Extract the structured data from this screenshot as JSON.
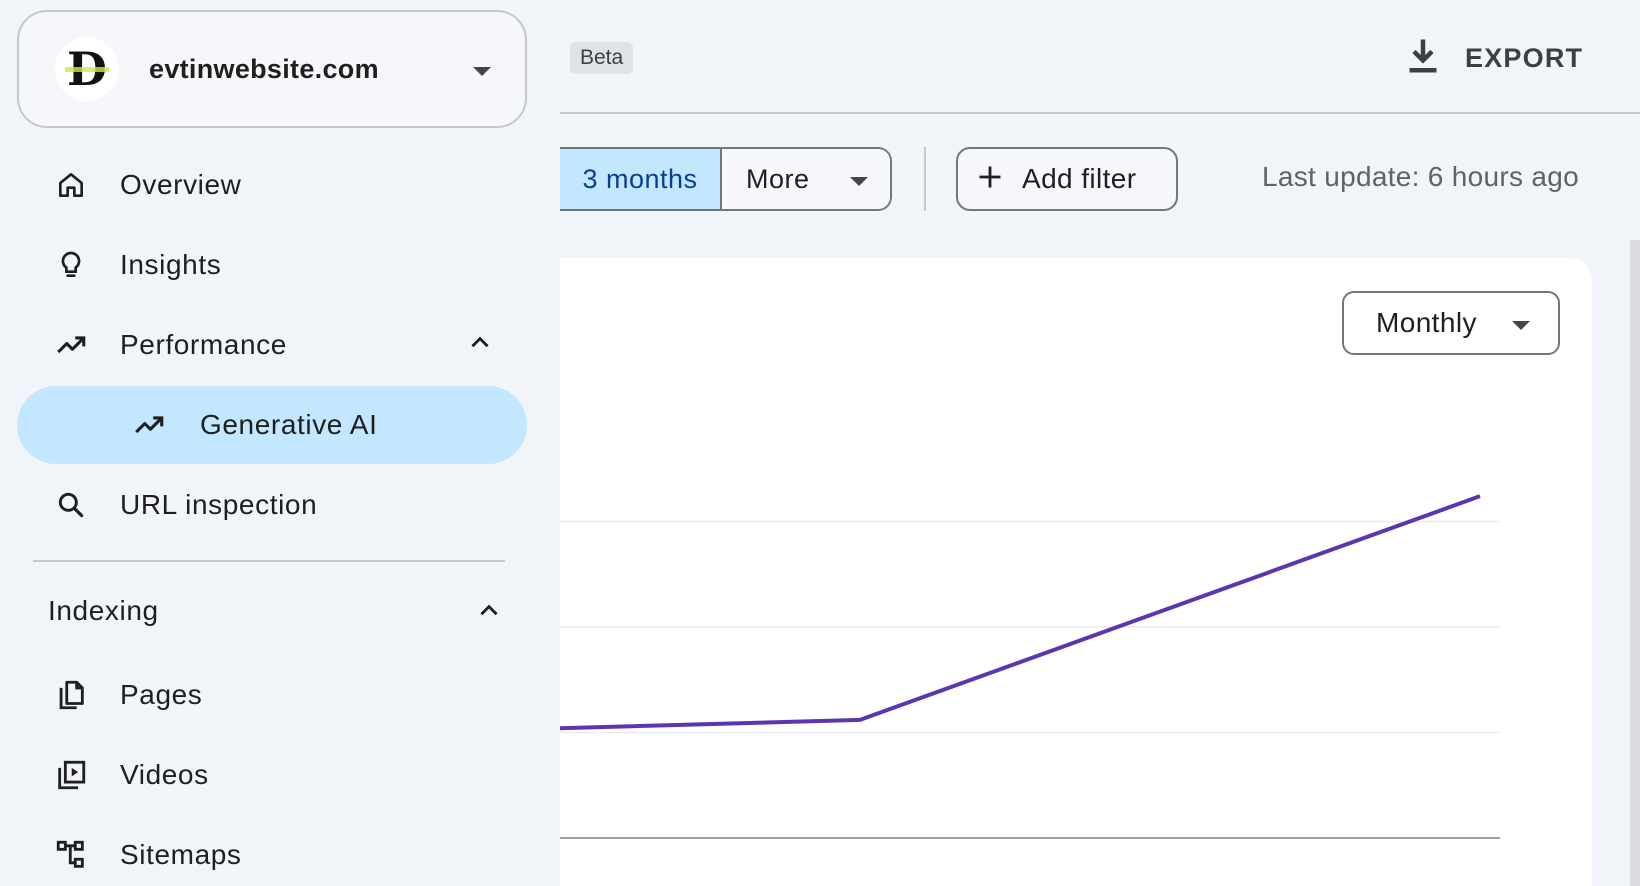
{
  "property": {
    "name": "evtinwebsite.com",
    "logo_letter": "D"
  },
  "nav": {
    "overview": "Overview",
    "insights": "Insights",
    "performance": "Performance",
    "generative_ai": "Generative AI",
    "url_inspection": "URL inspection",
    "indexing_header": "Indexing",
    "pages": "Pages",
    "videos": "Videos",
    "sitemaps": "Sitemaps"
  },
  "header": {
    "badge": "Beta",
    "export_label": "EXPORT"
  },
  "filters": {
    "range_selected": "3 months",
    "more_label": "More",
    "add_filter_label": "Add filter",
    "last_update": "Last update: 6 hours ago"
  },
  "chart_controls": {
    "granularity": "Monthly"
  },
  "colors": {
    "accent": "#c2e7ff",
    "series_line": "#5e35b1",
    "background": "#f1f4f8"
  },
  "chart_data": {
    "type": "line",
    "x": [
      "",
      "",
      ""
    ],
    "series": [
      {
        "values": [
          0.26,
          0.28,
          0.81
        ]
      }
    ],
    "ylim": [
      0,
      1
    ],
    "grid": true,
    "gridlines": 3
  }
}
